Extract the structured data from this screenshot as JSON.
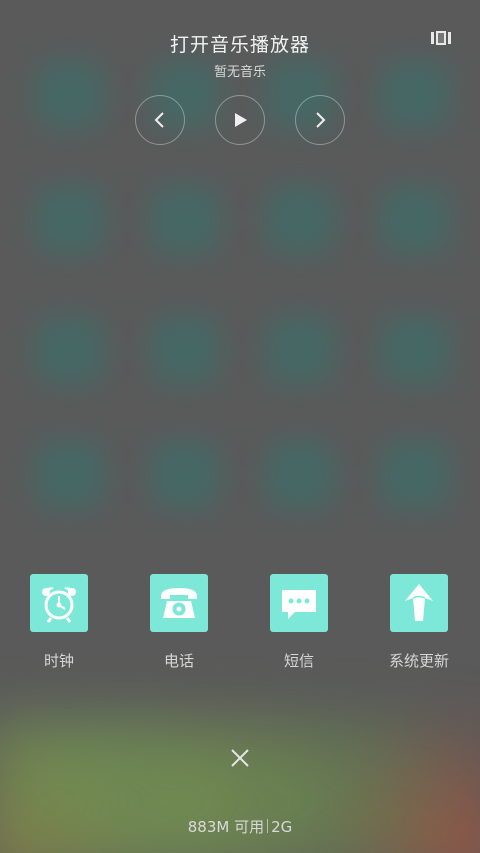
{
  "music": {
    "title": "打开音乐播放器",
    "subtitle": "暂无音乐"
  },
  "controls": {
    "prev_icon": "chevron-left-icon",
    "play_icon": "play-icon",
    "next_icon": "chevron-right-icon"
  },
  "shortcuts": [
    {
      "label": "时钟",
      "icon": "alarm-clock-icon"
    },
    {
      "label": "电话",
      "icon": "telephone-icon"
    },
    {
      "label": "短信",
      "icon": "message-icon"
    },
    {
      "label": "系统更新",
      "icon": "update-arrow-icon"
    }
  ],
  "status": {
    "memory": "883M 可用",
    "network": "2G"
  },
  "colors": {
    "tile": "#7ee8d8",
    "overlay": "#5a5a5a"
  }
}
